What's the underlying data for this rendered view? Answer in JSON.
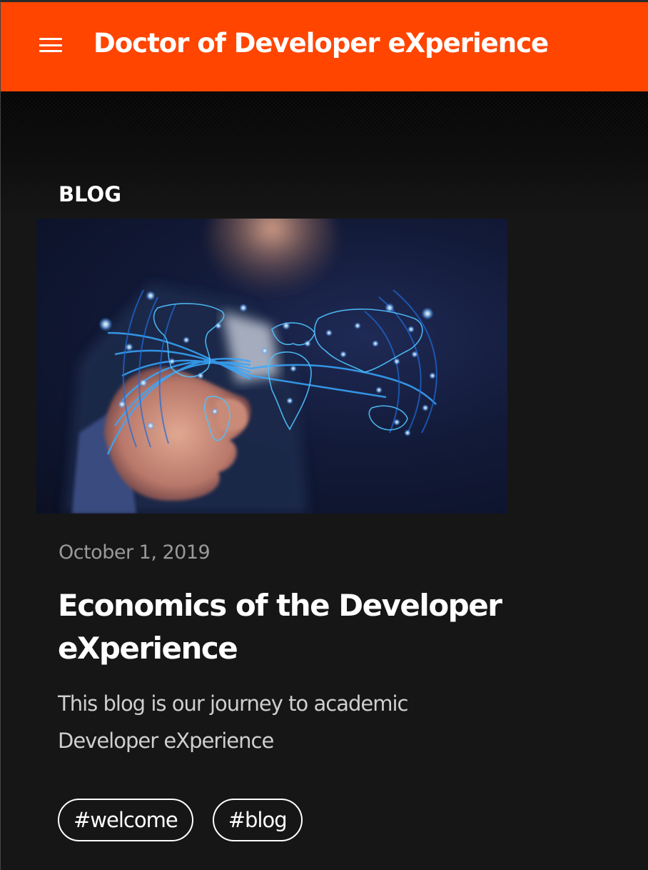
{
  "header": {
    "menu_icon": "hamburger-menu-icon",
    "title": "Doctor of Developer eXperience",
    "accent_color": "#ff4500"
  },
  "section": {
    "label": "BLOG"
  },
  "post": {
    "image_icon": "world-map-network-image",
    "date": "October 1, 2019",
    "title": "Economics of the Developer eXperience",
    "excerpt": "This blog is our journey to academic Developer eXperience",
    "tags": [
      "#welcome",
      "#blog"
    ]
  }
}
